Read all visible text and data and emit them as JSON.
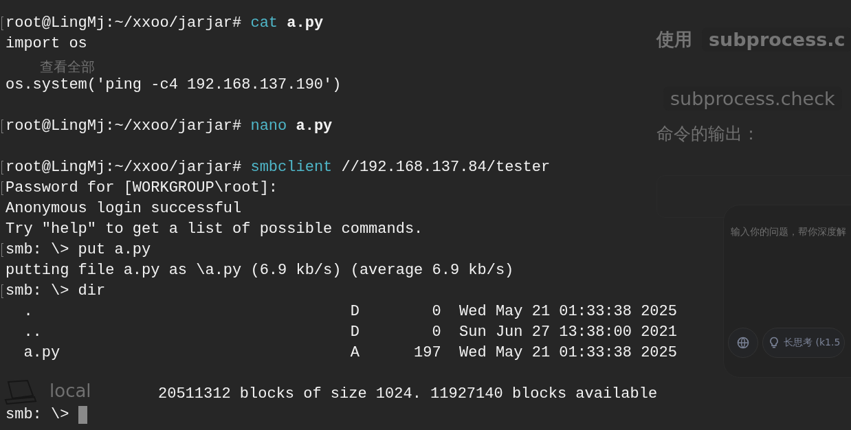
{
  "terminal": {
    "lines": [
      {
        "kind": "text",
        "marked": true,
        "segments": [
          {
            "text": "root@LingMj:~/xxoo/jarjar# ",
            "kind": "plain"
          },
          {
            "text": "cat ",
            "kind": "command"
          },
          {
            "text": "a.py",
            "kind": "bold"
          }
        ]
      },
      {
        "kind": "text",
        "marked": false,
        "segments": [
          {
            "text": "import os",
            "kind": "plain"
          }
        ]
      },
      {
        "kind": "blank"
      },
      {
        "kind": "text",
        "marked": false,
        "segments": [
          {
            "text": "os.system('ping -c4 192.168.137.190')",
            "kind": "plain"
          }
        ]
      },
      {
        "kind": "blank"
      },
      {
        "kind": "text",
        "marked": true,
        "segments": [
          {
            "text": "root@LingMj:~/xxoo/jarjar# ",
            "kind": "plain"
          },
          {
            "text": "nano ",
            "kind": "command"
          },
          {
            "text": "a.py",
            "kind": "bold"
          }
        ]
      },
      {
        "kind": "blank"
      },
      {
        "kind": "text",
        "marked": true,
        "segments": [
          {
            "text": "root@LingMj:~/xxoo/jarjar# ",
            "kind": "plain"
          },
          {
            "text": "smbclient ",
            "kind": "command"
          },
          {
            "text": "//192.168.137.84/tester",
            "kind": "plain"
          }
        ]
      },
      {
        "kind": "text",
        "marked": true,
        "segments": [
          {
            "text": "Password for [WORKGROUP\\root]:",
            "kind": "plain"
          }
        ]
      },
      {
        "kind": "text",
        "marked": false,
        "segments": [
          {
            "text": "Anonymous login successful",
            "kind": "plain"
          }
        ]
      },
      {
        "kind": "text",
        "marked": false,
        "segments": [
          {
            "text": "Try \"help\" to get a list of possible commands.",
            "kind": "plain"
          }
        ]
      },
      {
        "kind": "text",
        "marked": true,
        "segments": [
          {
            "text": "smb: \\> put a.py",
            "kind": "plain"
          }
        ]
      },
      {
        "kind": "text",
        "marked": false,
        "segments": [
          {
            "text": "putting file a.py as \\a.py (6.9 kb/s) (average 6.9 kb/s)",
            "kind": "plain"
          }
        ]
      },
      {
        "kind": "text",
        "marked": true,
        "segments": [
          {
            "text": "smb: \\> dir",
            "kind": "plain"
          }
        ]
      },
      {
        "kind": "text",
        "marked": false,
        "segments": [
          {
            "text": "  .                                   D        0  Wed May 21 01:33:38 2025",
            "kind": "plain"
          }
        ]
      },
      {
        "kind": "text",
        "marked": false,
        "segments": [
          {
            "text": "  ..                                  D        0  Sun Jun 27 13:38:00 2021",
            "kind": "plain"
          }
        ]
      },
      {
        "kind": "text",
        "marked": false,
        "segments": [
          {
            "text": "  a.py                                A      197  Wed May 21 01:33:38 2025",
            "kind": "plain"
          }
        ]
      },
      {
        "kind": "blank"
      },
      {
        "kind": "summary",
        "marked": false,
        "segments": [
          {
            "text": "20511312 blocks of size 1024. 11927140 blocks available",
            "kind": "plain"
          }
        ]
      },
      {
        "kind": "text",
        "marked": false,
        "cursor": true,
        "segments": [
          {
            "text": "smb: \\> ",
            "kind": "plain"
          }
        ]
      }
    ]
  },
  "background_page": {
    "view_all_link": "查看全部",
    "device_label": "local",
    "heading_prefix": "使用",
    "heading_code": "subprocess.c",
    "code_snippet": "subprocess.check",
    "output_caption": "命令的输出：",
    "input_placeholder": "输入你的问题，帮你深度解",
    "think_button": "长思考 (k1.5"
  }
}
